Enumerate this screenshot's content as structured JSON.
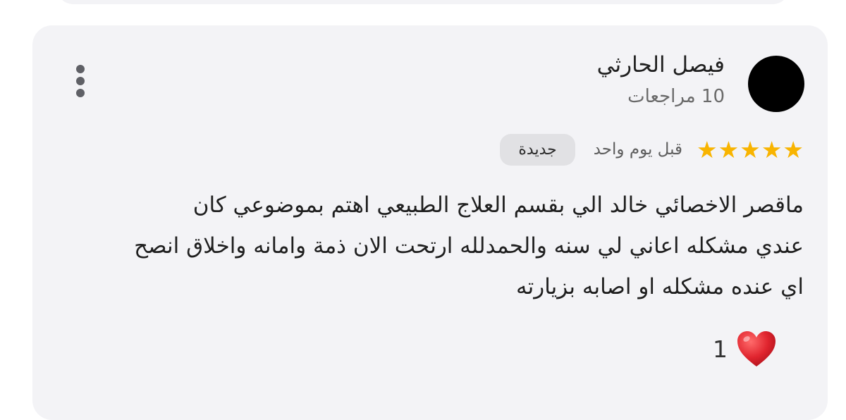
{
  "review": {
    "author_name": "فيصل الحارثي",
    "reviews_count": "10 مراجعات",
    "rating": 5,
    "date": "قبل يوم واحد",
    "badge": "جديدة",
    "text_lines": [
      "ماقصر الاخصائي خالد الي بقسم العلاج الطبيعي اهتم بموضوعي كان",
      "عندي مشكله اعاني لي سنه والحمدلله ارتحت الان ذمة وامانه واخلاق انصح",
      "اي عنده مشكله او اصابه بزيارته"
    ],
    "reaction_count": "1"
  },
  "colors": {
    "card_background": "#f3f3f6",
    "star": "#f8b400",
    "heart": "#e0242e",
    "badge_background": "#e1e1e4"
  },
  "icons": {
    "more_menu": "more-vertical-icon",
    "star": "star-icon",
    "reaction": "heart-icon"
  }
}
